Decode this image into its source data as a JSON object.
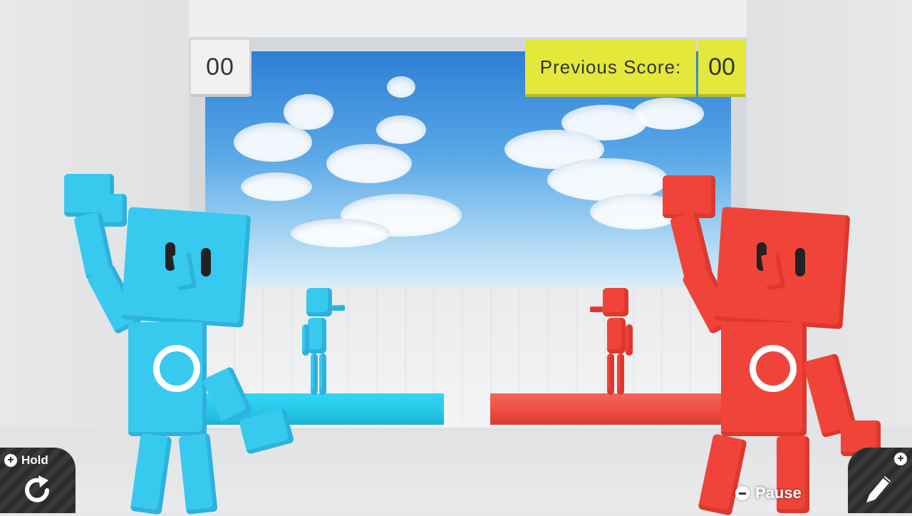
{
  "hud": {
    "player_score": "00",
    "previous_score_label": "Previous Score:",
    "previous_score_value": "00"
  },
  "controls": {
    "hold_label": "Hold",
    "pause_label": "Pause"
  },
  "colors": {
    "blue_player": "#38c9ef",
    "red_player": "#f0443a",
    "score_highlight": "#e3e83a"
  },
  "icons": {
    "hold": "rotate-icon",
    "edit": "pencil-icon",
    "pause": "minus-icon",
    "plus": "plus-icon"
  }
}
